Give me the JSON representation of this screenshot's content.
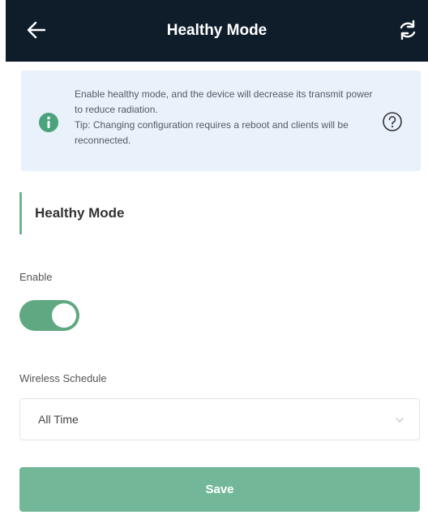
{
  "header": {
    "title": "Healthy Mode",
    "back_icon": "arrow-left-icon",
    "refresh_icon": "refresh-icon",
    "background": "#0f1d2b"
  },
  "tip": {
    "line1": "Enable healthy mode, and the device will decrease its transmit power to reduce radiation.",
    "line2": "Tip: Changing configuration requires a reboot and clients will be reconnected.",
    "info_icon": "info-icon",
    "help_icon": "question-circle-icon",
    "background": "#e9f1fb",
    "info_icon_color": "#4aa37a"
  },
  "section": {
    "title": "Healthy Mode",
    "accent": "#72b393"
  },
  "enable": {
    "label": "Enable",
    "on": true,
    "color": "#5fa882"
  },
  "schedule": {
    "label": "Wireless Schedule",
    "value": "All Time",
    "chevron_icon": "chevron-down-icon"
  },
  "save_button": {
    "label": "Save",
    "color": "#72b898"
  }
}
